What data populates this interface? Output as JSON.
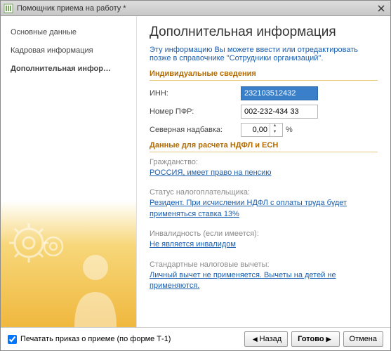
{
  "window": {
    "title": "Помощник приема на работу *"
  },
  "sidebar": {
    "items": [
      {
        "label": "Основные данные",
        "active": false
      },
      {
        "label": "Кадровая информация",
        "active": false
      },
      {
        "label": "Дополнительная инфор…",
        "active": true
      }
    ]
  },
  "main": {
    "heading": "Дополнительная информация",
    "intro": "Эту информацию Вы можете ввести или отредактировать позже в справочнике \"Сотрудники организаций\".",
    "section_individual": "Индивидуальные сведения",
    "inn_label": "ИНН:",
    "inn_value": "232103512432",
    "pfr_label": "Номер ПФР:",
    "pfr_value": "002-232-434 33",
    "north_label": "Северная надбавка:",
    "north_value": "0,00",
    "north_pct": "%",
    "section_ndfl": "Данные для расчета НДФЛ и ЕСН",
    "citizenship_label": "Гражданство:",
    "citizenship_link": "РОССИЯ, имеет право на пенсию",
    "tax_status_label": "Статус налогоплательщика:",
    "tax_status_link": "Резидент. При исчислении НДФЛ с оплаты труда будет применяться ставка 13%",
    "disability_label": "Инвалидность (если имеется):",
    "disability_link": "Не является инвалидом",
    "deductions_label": "Стандартные налоговые вычеты:",
    "deductions_link": "Личный вычет не применяется. Вычеты на детей не применяются."
  },
  "footer": {
    "print_label": "Печатать приказ о приеме (по форме Т-1)",
    "back": "Назад",
    "done": "Готово",
    "cancel": "Отмена"
  }
}
